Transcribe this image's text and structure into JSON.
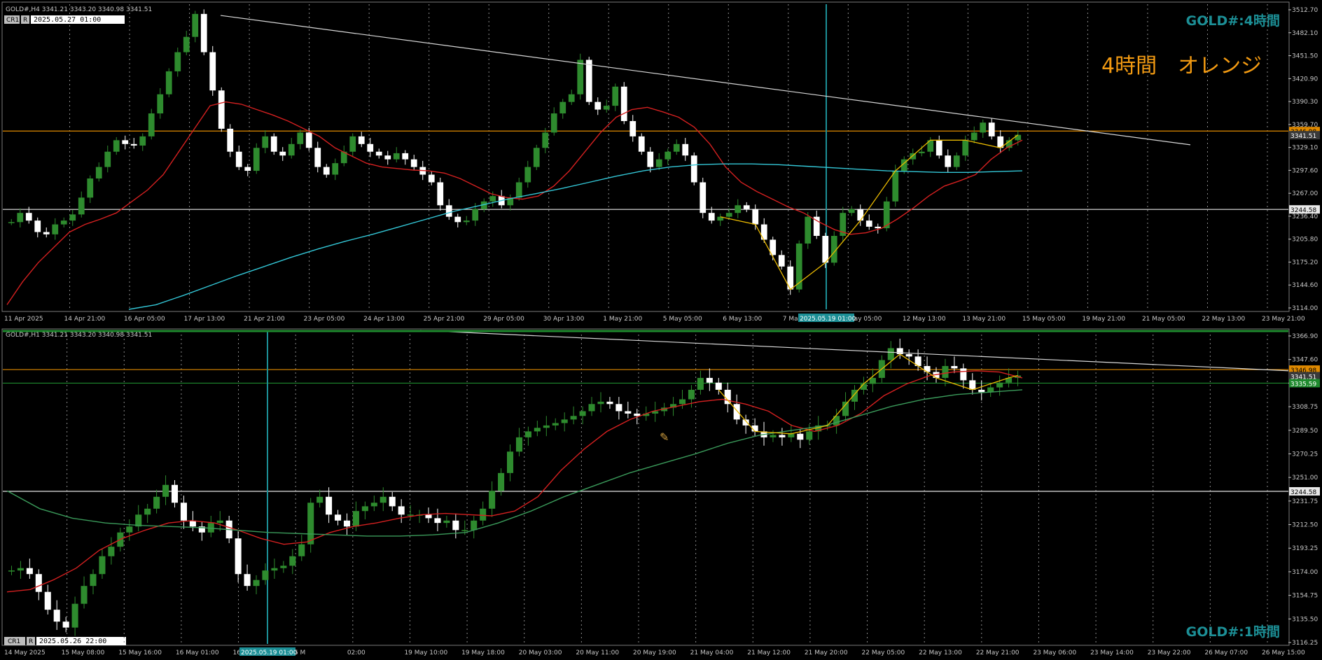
{
  "colors": {
    "background": "#000000",
    "up_candle": "#2e8b2e",
    "down_candle": "#ffffff",
    "ma_fast": "#d42020",
    "ma_slow_h4": "#33c6d6",
    "ma_slow_h1": "#3a9a5a",
    "zigzag": "#e8b800",
    "level_orange": "#e08a00",
    "level_white": "#e8e8e8",
    "trendline": "#d8d8d8",
    "cursor_line": "#1c8f96",
    "title_teal": "#1c8f96",
    "annotation_orange": "#f29a12",
    "grid": "#8a8a8a",
    "axis_text": "#c8c8c8"
  },
  "panels": [
    {
      "id": "h4",
      "header": "GOLD#,H4  3341.21 3343.20 3340.98 3341.51",
      "cr_label": "CR1",
      "r_label": "R",
      "cursor_time": "2025.05.27 01:00",
      "title": "GOLD#:4時間",
      "annotation": "4時間　オレンジ",
      "price_ticks": [
        "3512.70",
        "3482.10",
        "3451.50",
        "3420.90",
        "3390.30",
        "3359.70",
        "3329.10",
        "3297.60",
        "3267.00",
        "3236.40",
        "3205.80",
        "3175.20",
        "3144.60",
        "3114.00"
      ],
      "time_ticks": [
        "11 Apr 2025",
        "14 Apr 21:00",
        "16 Apr 05:00",
        "17 Apr 13:00",
        "21 Apr 21:00",
        "23 Apr 05:00",
        "24 Apr 13:00",
        "25 Apr 21:00",
        "29 Apr 05:00",
        "30 Apr 13:00",
        "1 May 21:00",
        "5 May 05:00",
        "6 May 13:00",
        "7 May 21:00",
        "9 May 05:00",
        "12 May 13:00",
        "13 May 21:00",
        "15 May 05:00",
        "19 May 21:00",
        "21 May 05:00",
        "22 May 13:00",
        "23 May 21:00"
      ],
      "highlight_time": "2025.05.19 01:00",
      "levels": [
        {
          "label": "3346.98",
          "value": 3346.98,
          "kind": "orange"
        },
        {
          "label": "3341.51",
          "value": 3341.51,
          "kind": "price"
        },
        {
          "label": "3244.58",
          "value": 3244.58,
          "kind": "white"
        }
      ]
    },
    {
      "id": "h1",
      "header": "GOLD#,H1  3341.21 3343.20 3340.98 3341.51",
      "cr_label": "CR1",
      "r_label": "R",
      "cursor_time": "2025.05.26 22:00",
      "title": "GOLD#:1時間",
      "price_ticks": [
        "3366.90",
        "3347.60",
        "3328.00",
        "3308.75",
        "3289.50",
        "3270.25",
        "3251.00",
        "3231.75",
        "3212.50",
        "3193.25",
        "3174.00",
        "3154.75",
        "3135.50",
        "3116.25"
      ],
      "time_ticks": [
        "14 May 2025",
        "15 May 08:00",
        "15 May 16:00",
        "16 May 01:00",
        "16 May 09:00",
        "16 M",
        "02:00",
        "19 May 10:00",
        "19 May 18:00",
        "20 May 03:00",
        "20 May 11:00",
        "20 May 19:00",
        "21 May 04:00",
        "21 May 12:00",
        "21 May 20:00",
        "22 May 05:00",
        "22 May 13:00",
        "22 May 21:00",
        "23 May 06:00",
        "23 May 14:00",
        "23 May 22:00",
        "26 May 07:00",
        "26 May 15:00"
      ],
      "highlight_time": "2025.05.19 01:00",
      "levels": [
        {
          "label": "3346.98",
          "value": 3346.98,
          "kind": "orange"
        },
        {
          "label": "3341.51",
          "value": 3341.51,
          "kind": "price"
        },
        {
          "label": "3335.59",
          "value": 3335.59,
          "kind": "green"
        },
        {
          "label": "3244.58",
          "value": 3244.58,
          "kind": "white"
        }
      ]
    }
  ],
  "chart_data": [
    {
      "type": "line",
      "symbol": "GOLD#",
      "timeframe": "H4",
      "title": "GOLD#:4時間",
      "ylim": [
        3114.0,
        3512.7
      ],
      "series": [
        {
          "values": [
            3228,
            3240,
            3230,
            3215,
            3212,
            3225,
            3230,
            3238,
            3260,
            3285,
            3300,
            3320,
            3335,
            3330,
            3328,
            3340,
            3370,
            3395,
            3425,
            3450,
            3470,
            3500,
            3450,
            3400,
            3350,
            3320,
            3300,
            3295,
            3325,
            3340,
            3320,
            3315,
            3330,
            3345,
            3325,
            3300,
            3290,
            3305,
            3320,
            3340,
            3330,
            3320,
            3315,
            3310,
            3318,
            3310,
            3300,
            3290,
            3280,
            3250,
            3235,
            3228,
            3230,
            3245,
            3255,
            3262,
            3250,
            3260,
            3280,
            3300,
            3325,
            3345,
            3370,
            3385,
            3395,
            3440,
            3385,
            3375,
            3380,
            3405,
            3360,
            3340,
            3320,
            3300,
            3310,
            3320,
            3330,
            3315,
            3280,
            3240,
            3230,
            3235,
            3240,
            3250,
            3245,
            3225,
            3205,
            3185,
            3170,
            3140,
            3200,
            3235,
            3210,
            3175,
            3210,
            3240,
            3245,
            3230,
            3222,
            3220,
            3255,
            3295,
            3310,
            3318,
            3320,
            3335,
            3315,
            3300,
            3315,
            3335,
            3345,
            3358,
            3340,
            3325,
            3335,
            3342
          ]
        },
        {
          "values": [
            3120,
            3150,
            3175,
            3195,
            3215,
            3225,
            3232,
            3240,
            3255,
            3270,
            3290,
            3320,
            3350,
            3380,
            3385,
            3382,
            3375,
            3368,
            3360,
            3350,
            3340,
            3325,
            3315,
            3305,
            3300,
            3298,
            3296,
            3295,
            3292,
            3285,
            3275,
            3265,
            3260,
            3258,
            3262,
            3275,
            3295,
            3320,
            3345,
            3365,
            3375,
            3378,
            3372,
            3365,
            3352,
            3330,
            3300,
            3280,
            3268,
            3258,
            3248,
            3240,
            3228,
            3218,
            3212,
            3214,
            3220,
            3232,
            3246,
            3262,
            3275,
            3282,
            3290,
            3310,
            3325,
            3335
          ]
        },
        {
          "values": [
            3114,
            3120,
            3132,
            3145,
            3158,
            3170,
            3182,
            3193,
            3203,
            3212,
            3222,
            3232,
            3242,
            3250,
            3258,
            3265,
            3272,
            3280,
            3288,
            3295,
            3300,
            3303,
            3304,
            3304,
            3303,
            3301,
            3299,
            3297,
            3295,
            3294,
            3293,
            3293,
            3294,
            3295
          ]
        }
      ],
      "trendline_points": [
        [
          3498,
          "11 Apr 2025"
        ],
        [
          3330,
          "25 May 2025"
        ]
      ],
      "levels": [
        3346.98,
        3244.58
      ],
      "grid": true,
      "legend": "none"
    },
    {
      "type": "line",
      "symbol": "GOLD#",
      "timeframe": "H1",
      "title": "GOLD#:1時間",
      "ylim": [
        3116.25,
        3380.0
      ],
      "series": [
        {
          "values": [
            3178,
            3180,
            3175,
            3160,
            3145,
            3135,
            3130,
            3150,
            3165,
            3175,
            3190,
            3198,
            3210,
            3215,
            3225,
            3230,
            3240,
            3250,
            3235,
            3220,
            3215,
            3210,
            3218,
            3220,
            3205,
            3175,
            3165,
            3170,
            3178,
            3180,
            3182,
            3190,
            3200,
            3235,
            3240,
            3225,
            3220,
            3215,
            3228,
            3232,
            3235,
            3240,
            3232,
            3225,
            3225,
            3225,
            3222,
            3218,
            3220,
            3212,
            3212,
            3220,
            3230,
            3245,
            3260,
            3278,
            3290,
            3295,
            3298,
            3300,
            3302,
            3305,
            3308,
            3312,
            3318,
            3320,
            3318,
            3312,
            3310,
            3308,
            3310,
            3312,
            3315,
            3318,
            3322,
            3330,
            3340,
            3336,
            3330,
            3318,
            3305,
            3300,
            3295,
            3290,
            3292,
            3290,
            3293,
            3288,
            3295,
            3300,
            3300,
            3308,
            3320,
            3330,
            3335,
            3340,
            3355,
            3365,
            3360,
            3358,
            3350,
            3345,
            3340,
            3350,
            3348,
            3338,
            3330,
            3328,
            3332,
            3336,
            3340,
            3342
          ]
        },
        {
          "values": [
            3160,
            3162,
            3170,
            3180,
            3195,
            3205,
            3212,
            3218,
            3220,
            3218,
            3212,
            3205,
            3200,
            3202,
            3210,
            3215,
            3218,
            3222,
            3225,
            3226,
            3225,
            3224,
            3228,
            3240,
            3262,
            3280,
            3295,
            3305,
            3312,
            3316,
            3320,
            3322,
            3318,
            3312,
            3300,
            3295,
            3300,
            3310,
            3325,
            3335,
            3342,
            3345,
            3346,
            3345,
            3340
          ]
        },
        {
          "values": [
            3245,
            3230,
            3222,
            3218,
            3216,
            3215,
            3214,
            3212,
            3210,
            3209,
            3208,
            3207,
            3207,
            3208,
            3210,
            3218,
            3228,
            3240,
            3250,
            3260,
            3268,
            3276,
            3285,
            3292,
            3296,
            3300,
            3308,
            3316,
            3322,
            3326,
            3328,
            3330
          ]
        }
      ],
      "levels": [
        3346.98,
        3335.59,
        3244.58
      ],
      "grid": true,
      "legend": "none"
    }
  ]
}
